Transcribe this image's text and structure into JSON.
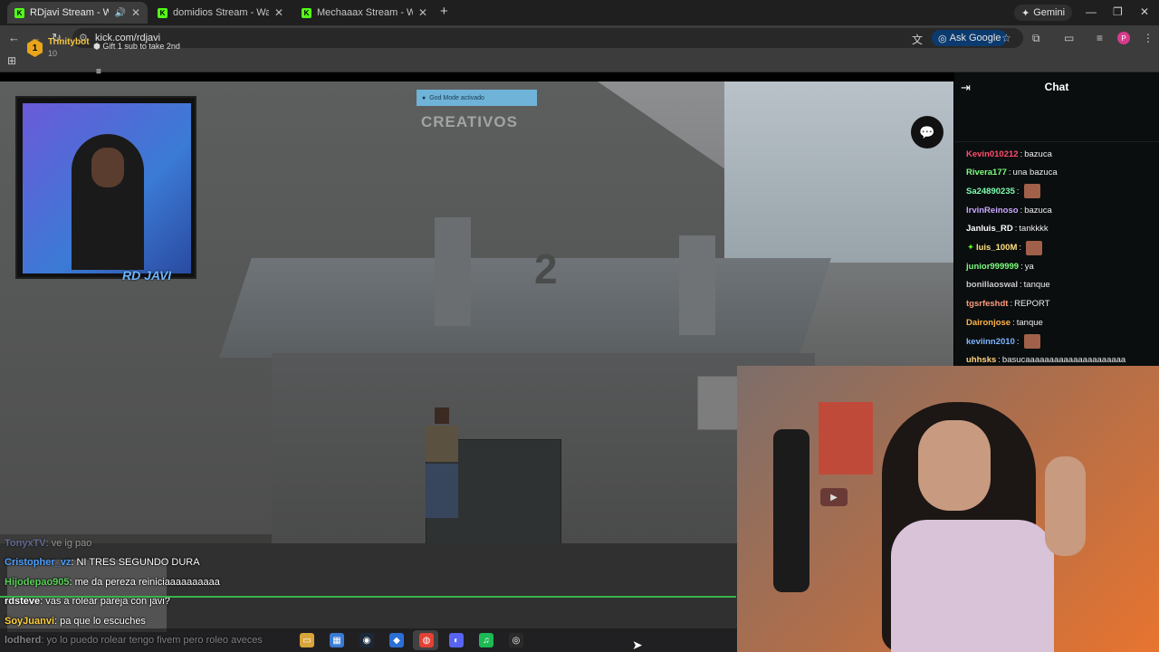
{
  "browser": {
    "tabs": [
      {
        "title": "RDjavi Stream - Watch Live",
        "active": true,
        "audio": true
      },
      {
        "title": "domidios Stream - Watch Live o",
        "active": false
      },
      {
        "title": "Mechaaax Stream - Watch Live",
        "active": false
      }
    ],
    "gemini_label": "Gemini",
    "url": "kick.com/rdjavi",
    "ask_google_label": "Ask Google",
    "profile_initial": "P"
  },
  "stream": {
    "hud_notification": "God Mode activado",
    "watermark": "CREATIVOS",
    "streamer_cam_label": "RD JAVI",
    "overlay_chat": [
      {
        "user": "TonyxTV",
        "text": ": ve ig pao",
        "color": "#9aa3ff",
        "faded": true
      },
      {
        "user": "Cristopher_vz",
        "text": ": NI TRES SEGUNDO DURA",
        "color": "#4ea0ff",
        "faded": false
      },
      {
        "user": "Hijodepao905",
        "text": ": me da pereza reiniciaaaaaaaaaa",
        "color": "#5ad35a",
        "faded": false
      },
      {
        "user": "rdsteve",
        "text": ": vas a rolear pareja con javi?",
        "color": "#ffffff",
        "faded": false
      },
      {
        "user": "SoyJuanvi",
        "text": ": pa que lo escuches",
        "color": "#ffd23f",
        "faded": false
      },
      {
        "user": "lodherd",
        "text": ": yo lo puedo rolear tengo fivem pero roleo aveces",
        "color": "#ffffff",
        "faded": false
      }
    ]
  },
  "chat": {
    "title": "Chat",
    "pinned": {
      "badge": "1",
      "name": "Trinitybot",
      "count": "10",
      "gift_text": "Gift 1 sub to take 2nd"
    },
    "messages": [
      {
        "user": "Kevin010212",
        "text": "bazuca",
        "color": "#ff4d6d",
        "emote": false,
        "badge": false
      },
      {
        "user": "Rivera177",
        "text": "una bazuca",
        "color": "#7dff7d",
        "emote": false,
        "badge": false
      },
      {
        "user": "Sa24890235",
        "text": "",
        "color": "#7dffb0",
        "emote": true,
        "badge": false
      },
      {
        "user": "IrvinReinoso",
        "text": "bazuca",
        "color": "#c9a6ff",
        "emote": false,
        "badge": false
      },
      {
        "user": "Janluis_RD",
        "text": "tankkkk",
        "color": "#ffffff",
        "emote": false,
        "badge": false
      },
      {
        "user": "luis_100M",
        "text": "",
        "color": "#ffe07d",
        "emote": true,
        "badge": true
      },
      {
        "user": "junior999999",
        "text": "ya",
        "color": "#7dff7d",
        "emote": false,
        "badge": false
      },
      {
        "user": "bonillaoswal",
        "text": "tanque",
        "color": "#c8c8c8",
        "emote": false,
        "badge": false
      },
      {
        "user": "tgsrfeshdt",
        "text": "REPORT",
        "color": "#ff9a7d",
        "emote": false,
        "badge": false
      },
      {
        "user": "Daironjose",
        "text": "tanque",
        "color": "#ffb347",
        "emote": false,
        "badge": false
      },
      {
        "user": "keviinn2010",
        "text": "",
        "color": "#7db5ff",
        "emote": true,
        "badge": false
      },
      {
        "user": "uhhsks",
        "text": "basucaaaaaaaaaaaaaaaaaaaaa",
        "color": "#ffd27d",
        "emote": false,
        "badge": false
      }
    ]
  },
  "taskbar": {
    "icons": [
      "file-explorer-icon",
      "store-icon",
      "steam-icon",
      "app-icon",
      "chrome-icon",
      "discord-icon",
      "spotify-icon",
      "obs-icon"
    ]
  }
}
